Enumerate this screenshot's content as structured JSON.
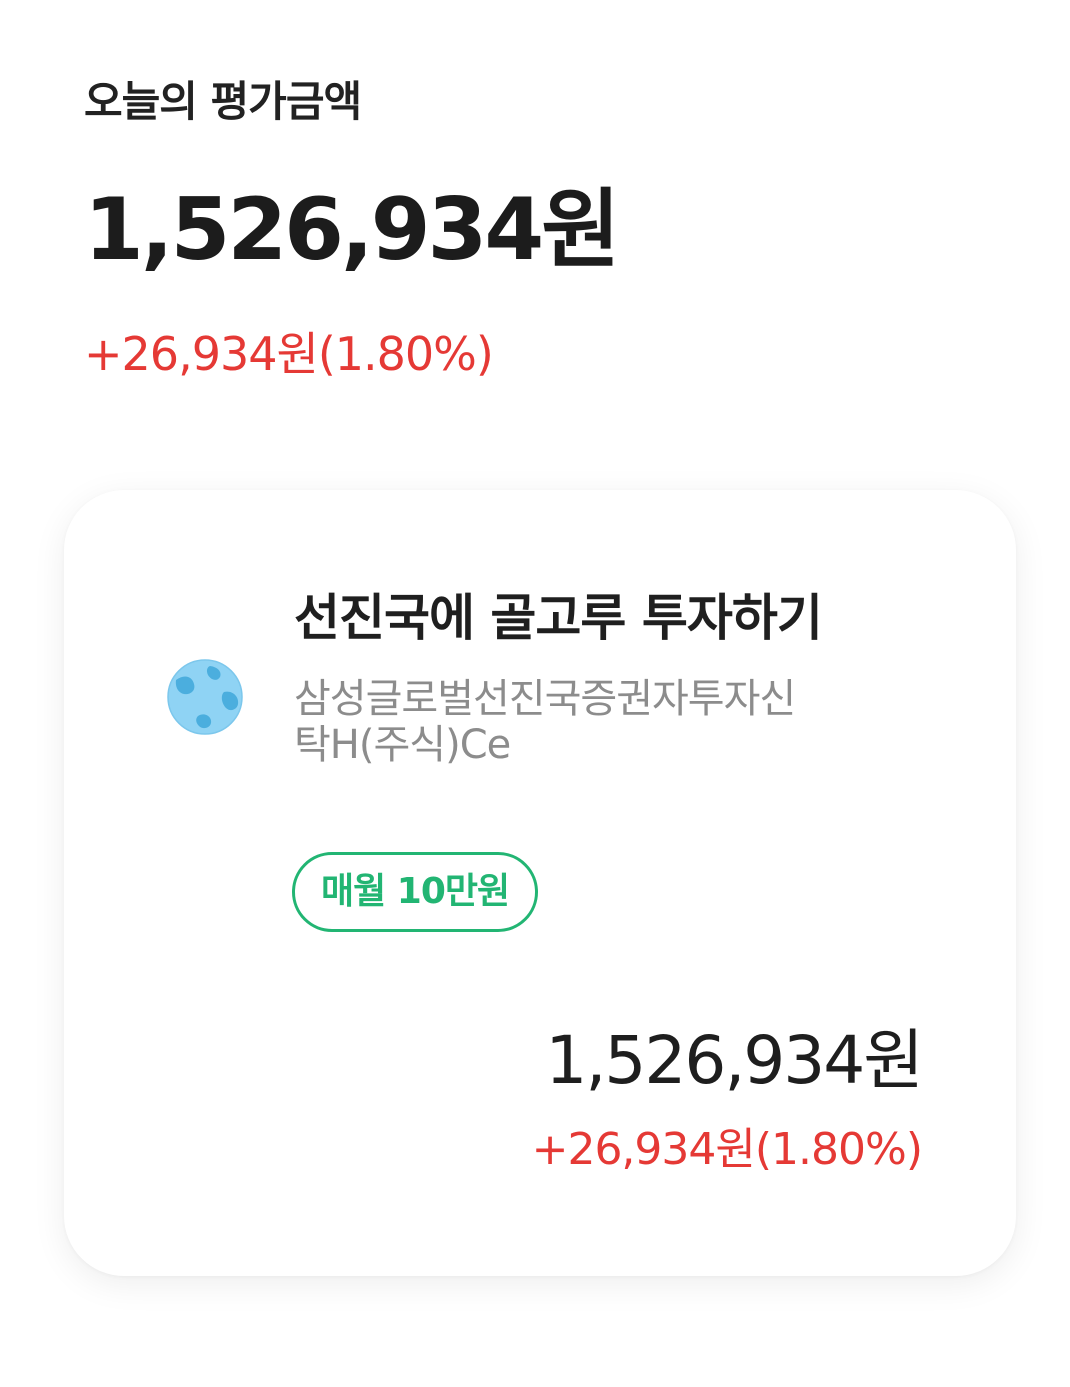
{
  "summary": {
    "label": "오늘의 평가금액",
    "amount": "1,526,934원",
    "change": "+26,934원(1.80%)"
  },
  "fund_card": {
    "icon": "globe-icon",
    "title": "선진국에 골고루 투자하기",
    "name_line1": "삼성글로벌선진국증권자투자신",
    "name_line2": "탁H(주식)Ce",
    "plan_badge": "매월 10만원",
    "amount": "1,526,934원",
    "change": "+26,934원(1.80%)"
  },
  "colors": {
    "positive": "#e53935",
    "badge": "#22b573",
    "text_primary": "#1e1e1e",
    "text_secondary": "#8c8c8c",
    "globe_ocean": "#8fd3f4",
    "globe_land": "#3fa7d9"
  }
}
